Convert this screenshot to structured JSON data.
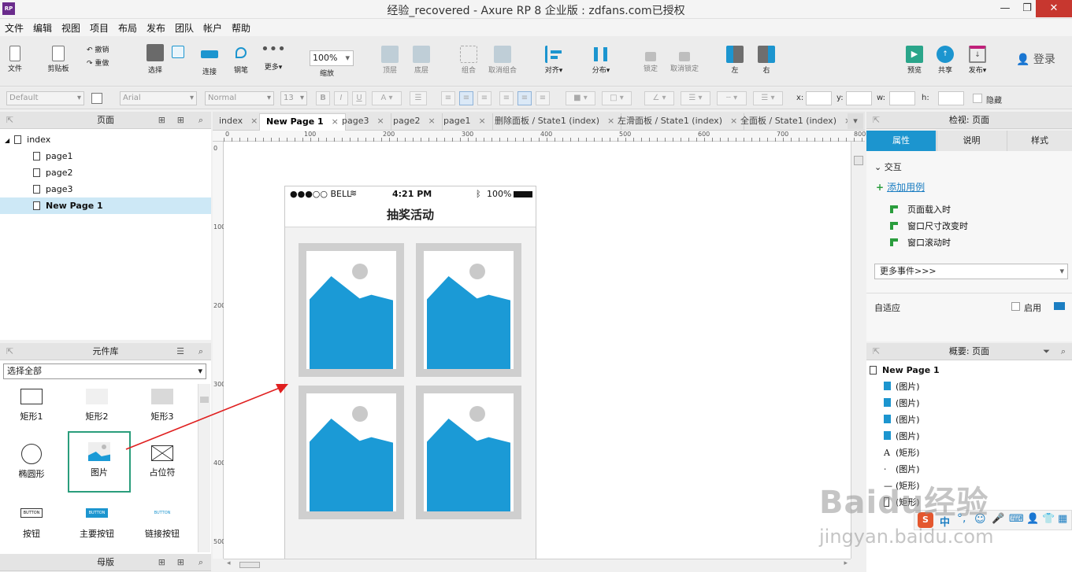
{
  "window": {
    "title": "经验_recovered - Axure RP 8 企业版 : zdfans.com已授权",
    "app_icon": "RP",
    "min": "—",
    "max": "❐",
    "close": "✕"
  },
  "menu": [
    "文件",
    "编辑",
    "视图",
    "项目",
    "布局",
    "发布",
    "团队",
    "帐户",
    "帮助"
  ],
  "toolbar": {
    "file": "文件",
    "clipboard": "剪贴板",
    "undo": "撤销",
    "redo": "重做",
    "select": "选择",
    "connect": "连接",
    "pen": "钢笔",
    "more": "更多▾",
    "zoom": "100%",
    "zoom_label": "缩放",
    "top": "顶层",
    "bottom": "底层",
    "group": "组合",
    "ungroup": "取消组合",
    "align": "对齐▾",
    "distribute": "分布▾",
    "lock": "锁定",
    "unlock": "取消锁定",
    "left": "左",
    "right": "右",
    "preview": "预览",
    "share": "共享",
    "publish": "发布▾",
    "login": "登录"
  },
  "format": {
    "style": "Default",
    "font": "Arial",
    "weight": "Normal",
    "size": "13",
    "x": "x:",
    "y": "y:",
    "w": "w:",
    "h": "h:",
    "hide": "隐藏"
  },
  "pages_panel": {
    "title": "页面",
    "items": [
      {
        "label": "index",
        "level": 0
      },
      {
        "label": "page1",
        "level": 1
      },
      {
        "label": "page2",
        "level": 1
      },
      {
        "label": "page3",
        "level": 1
      },
      {
        "label": "New Page 1",
        "level": 1,
        "selected": true
      }
    ]
  },
  "library_panel": {
    "title": "元件库",
    "filter": "选择全部",
    "items": [
      {
        "label": "矩形1",
        "icon": "rect1"
      },
      {
        "label": "矩形2",
        "icon": "rect2"
      },
      {
        "label": "矩形3",
        "icon": "rect3"
      },
      {
        "label": "椭圆形",
        "icon": "ellipse"
      },
      {
        "label": "图片",
        "icon": "image",
        "selected": true
      },
      {
        "label": "占位符",
        "icon": "placeholder"
      },
      {
        "label": "按钮",
        "icon": "button",
        "text": "BUTTON"
      },
      {
        "label": "主要按钮",
        "icon": "primary-button",
        "text": "BUTTON"
      },
      {
        "label": "链接按钮",
        "icon": "link-button",
        "text": "BUTTON"
      }
    ]
  },
  "masters_panel": {
    "title": "母版"
  },
  "tabs": [
    {
      "label": "index"
    },
    {
      "label": "New Page 1",
      "active": true
    },
    {
      "label": "page3"
    },
    {
      "label": "page2"
    },
    {
      "label": "page1"
    },
    {
      "label": "删除面板 / State1 (index)"
    },
    {
      "label": "左滑面板 / State1 (index)"
    },
    {
      "label": "全面板 / State1 (index)"
    }
  ],
  "ruler": {
    "h": [
      "0",
      "100",
      "200",
      "300",
      "400",
      "500",
      "600",
      "700",
      "800"
    ],
    "v": [
      "0",
      "100",
      "200",
      "300",
      "400",
      "500"
    ]
  },
  "phone": {
    "carrier": "●●●○○ BELL",
    "time": "4:21 PM",
    "battery": "100%",
    "title": "抽奖活动"
  },
  "inspector": {
    "title": "检视: 页面",
    "tabs": [
      "属性",
      "说明",
      "样式"
    ],
    "section": "交互",
    "add_case": "添加用例",
    "events": [
      "页面载入时",
      "窗口尺寸改变时",
      "窗口滚动时"
    ],
    "more_events": "更多事件>>>",
    "adaptive": "自适应",
    "enable": "启用"
  },
  "outline": {
    "title": "概要: 页面",
    "root": "New Page 1",
    "items": [
      {
        "label": "(图片)",
        "icon": "image"
      },
      {
        "label": "(图片)",
        "icon": "image"
      },
      {
        "label": "(图片)",
        "icon": "image"
      },
      {
        "label": "(图片)",
        "icon": "image"
      },
      {
        "label": "(矩形)",
        "icon": "text"
      },
      {
        "label": "(图片)",
        "icon": "image-small"
      },
      {
        "label": "(矩形)",
        "icon": "line"
      },
      {
        "label": "(矩形)",
        "icon": "rect"
      }
    ]
  },
  "watermark": {
    "text": "Baidu经验",
    "url": "jingyan.baidu.com"
  },
  "colors": {
    "accent": "#1c95cf",
    "image_blue": "#1b9ad6",
    "arrow": "#e02020",
    "selected_row": "#cde8f6"
  }
}
